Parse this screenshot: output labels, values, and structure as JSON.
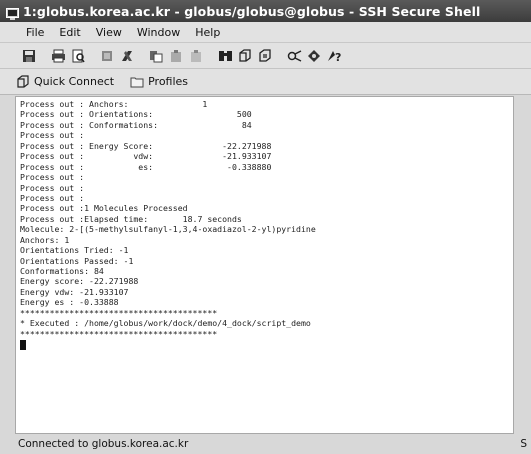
{
  "window": {
    "title": "1:globus.korea.ac.kr - globus/globus@globus - SSH Secure Shell"
  },
  "menu": [
    "File",
    "Edit",
    "View",
    "Window",
    "Help"
  ],
  "toolbar": {
    "icons": [
      "save-icon",
      "print-icon",
      "print-preview-icon",
      "cut-icon",
      "copy-icon",
      "paste-icon",
      "paste-special-icon",
      "paste-alt-icon",
      "find-icon",
      "new-terminal-icon",
      "new-file-transfer-icon",
      "settings-icon",
      "disconnect-icon",
      "help-icon"
    ]
  },
  "quickbar": {
    "quick_connect": "Quick Connect",
    "profiles": "Profiles"
  },
  "terminal": {
    "lines": [
      "Process out : Anchors:               1",
      "Process out : Orientations:                 500",
      "Process out : Conformations:                 84",
      "Process out :",
      "Process out : Energy Score:              -22.271988",
      "Process out :          vdw:              -21.933107",
      "Process out :           es:               -0.338880",
      "Process out :",
      "Process out :",
      "Process out :",
      "Process out :1 Molecules Processed",
      "Process out :Elapsed time:       18.7 seconds",
      "Molecule: 2-[(5-methylsulfanyl-1,3,4-oxadiazol-2-yl)pyridine",
      "Anchors: 1",
      "Orientations Tried: -1",
      "Orientations Passed: -1",
      "Conformations: 84",
      "Energy score: -22.271988",
      "Energy vdw: -21.933107",
      "Energy es : -0.33888",
      "****************************************",
      "* Executed : /home/globus/work/dock/demo/4_dock/script_demo",
      "****************************************"
    ]
  },
  "status": {
    "text": "Connected to globus.korea.ac.kr",
    "right": "S"
  }
}
